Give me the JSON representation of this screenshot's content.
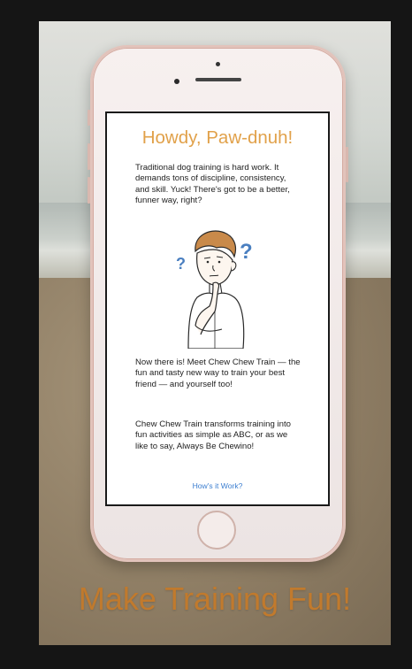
{
  "screen": {
    "title": "Howdy, Paw-dnuh!",
    "paragraph_1": "Traditional dog training is hard work. It demands tons of discipline, consistency, and skill. Yuck! There's got to be a better, funner way, right?",
    "paragraph_2": "Now there is! Meet Chew Chew Train — the fun and tasty new way to train your best friend — and yourself too!",
    "paragraph_3": "Chew Chew Train transforms training into fun activities as simple as ABC, or as we like to say, Always Be Chewino!",
    "link_label": "How's it Work?",
    "illustration_marks": [
      "?",
      "?"
    ]
  },
  "tagline": "Make Training Fun!",
  "colors": {
    "title": "#e1a14a",
    "tagline": "#c17a2d",
    "link": "#3b7ed0",
    "phone_frame": "#e2c3bb",
    "question_mark": "#4a7fc0"
  }
}
